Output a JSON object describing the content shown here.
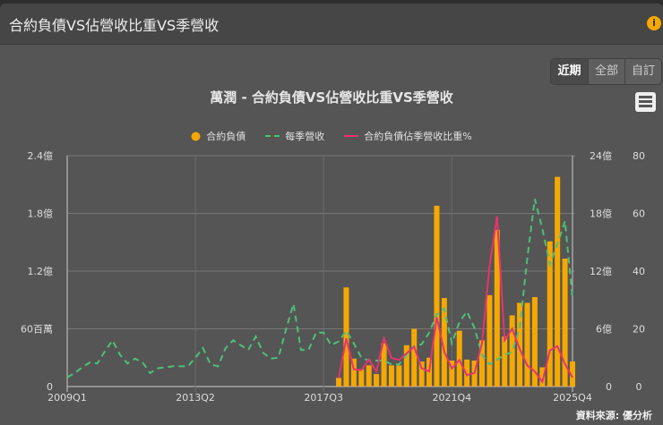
{
  "header": {
    "title": "合約負債VS佔營收比重VS季營收",
    "info_icon": "i"
  },
  "range_buttons": [
    "近期",
    "全部",
    "自訂"
  ],
  "colors": {
    "bar": "#f5a800",
    "revenue": "#4cc07a",
    "ratio": "#e8336f"
  },
  "source": "資料來源: 優分析",
  "chart_data": {
    "type": "bar+line",
    "title": "萬潤 - 合約負債VS佔營收比重VS季營收",
    "legend": [
      "合約負債",
      "每季營收",
      "合約負債佔季營收比重%"
    ],
    "legend_placement": "top-center",
    "x_start": "2009Q1",
    "x_end": "2025Q4",
    "x_tick_labels": [
      "2009Q1",
      "2013Q2",
      "2017Q3",
      "2021Q4",
      "2025Q4"
    ],
    "y_left": {
      "ticks": [
        "0",
        "60百萬",
        "1.2億",
        "1.8億",
        "2.4億"
      ],
      "range_yi": [
        0,
        2.4
      ]
    },
    "y_right1": {
      "ticks": [
        "0",
        "6億",
        "12億",
        "18億",
        "24億"
      ],
      "range_yi": [
        0,
        24
      ]
    },
    "y_right2": {
      "ticks": [
        "0",
        "20",
        "40",
        "60",
        "80"
      ],
      "range": [
        0,
        80
      ]
    },
    "contract_liabilities_yi": {
      "start_index": 36,
      "values": [
        0.09,
        1.03,
        0.29,
        0.18,
        0.22,
        0.13,
        0.45,
        0.22,
        0.22,
        0.43,
        0.6,
        0.26,
        0.3,
        1.88,
        0.92,
        0.27,
        0.58,
        0.28,
        0.27,
        0.48,
        0.95,
        1.63,
        0.52,
        0.74,
        0.87,
        0.87,
        0.93,
        0.2,
        1.51,
        2.18,
        1.33,
        0.26
      ]
    },
    "quarterly_revenue_yi": {
      "start_index": 0,
      "values": [
        0.95,
        1.4,
        2.0,
        2.5,
        2.4,
        3.65,
        4.8,
        3.3,
        2.4,
        2.9,
        2.5,
        1.4,
        1.9,
        2.0,
        2.1,
        2.1,
        2.1,
        3.0,
        4.0,
        2.3,
        2.1,
        4.0,
        4.8,
        4.3,
        3.8,
        5.2,
        3.5,
        2.9,
        3.0,
        5.9,
        8.6,
        3.8,
        3.8,
        5.6,
        5.6,
        4.3,
        4.7,
        5.8,
        4.5,
        3.0,
        2.7,
        2.7,
        2.7,
        2.3,
        2.3,
        3.3,
        4.2,
        4.4,
        5.6,
        7.5,
        8.1,
        4.5,
        6.7,
        7.8,
        6.1,
        3.3,
        2.3,
        2.8,
        3.3,
        3.6,
        6.1,
        13.3,
        19.5,
        16.4,
        12.7,
        14.8,
        17.2,
        9.2
      ]
    },
    "ratio_pct": {
      "start_index": 36,
      "values": [
        2.9,
        16.7,
        6,
        5.7,
        9.4,
        5.2,
        16.7,
        9.9,
        9.2,
        11.5,
        13.8,
        6.3,
        5.2,
        24,
        12,
        6.3,
        9.2,
        3.9,
        4.7,
        15,
        41.7,
        59,
        16,
        20,
        13,
        7.3,
        5.2,
        1.6,
        12.5,
        14,
        7.8,
        3.1
      ]
    }
  }
}
